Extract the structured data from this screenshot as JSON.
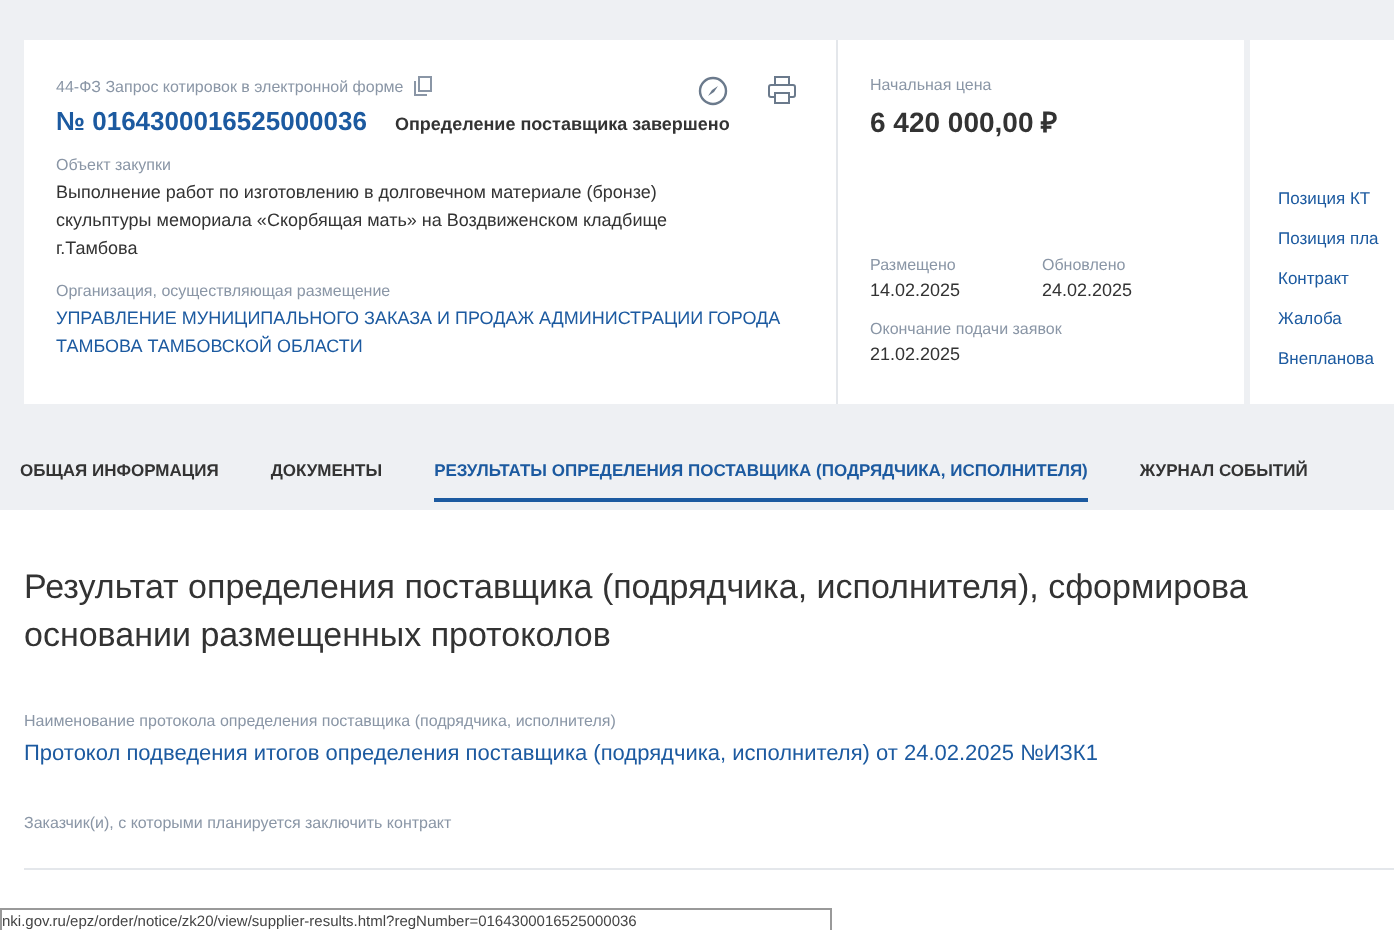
{
  "card": {
    "law_type": "44-ФЗ Запрос котировок в электронной форме",
    "number": "№ 0164300016525000036",
    "status": "Определение поставщика завершено",
    "object_label": "Объект закупки",
    "object_text": "Выполнение работ по изготовлению в долговечном материале (бронзе) скульптуры мемориала «Скорбящая мать» на Воздвиженском кладбище г.Тамбова",
    "org_label": "Организация, осуществляющая размещение",
    "org_name": "УПРАВЛЕНИЕ МУНИЦИПАЛЬНОГО ЗАКАЗА И ПРОДАЖ АДМИНИСТРАЦИИ ГОРОДА ТАМБОВА ТАМБОВСКОЙ ОБЛАСТИ"
  },
  "price": {
    "label": "Начальная цена",
    "value": "6 420 000,00 ₽"
  },
  "dates": [
    {
      "label": "Размещено",
      "value": "14.02.2025"
    },
    {
      "label": "Обновлено",
      "value": "24.02.2025"
    },
    {
      "label": "Окончание подачи заявок",
      "value": "21.02.2025"
    }
  ],
  "links": [
    "Позиция КТ",
    "Позиция пла",
    "Контракт",
    "Жалоба",
    "Внепланова"
  ],
  "tabs": [
    {
      "label": "ОБЩАЯ ИНФОРМАЦИЯ",
      "selected": false
    },
    {
      "label": "ДОКУМЕНТЫ",
      "selected": false
    },
    {
      "label": "РЕЗУЛЬТАТЫ ОПРЕДЕЛЕНИЯ ПОСТАВЩИКА (ПОДРЯДЧИКА, ИСПОЛНИТЕЛЯ)",
      "selected": true
    },
    {
      "label": "ЖУРНАЛ СОБЫТИЙ",
      "selected": false
    }
  ],
  "heading_lines": [
    "Результат определения поставщика (подрядчика, исполнителя), сформирова",
    "основании размещенных протоколов"
  ],
  "protocol": {
    "label": "Наименование протокола определения поставщика (подрядчика, исполнителя)",
    "title": "Протокол подведения итогов определения поставщика (подрядчика, исполнителя) от 24.02.2025 №ИЗК1"
  },
  "customers_label": "Заказчик(и), с которыми планируется заключить контракт",
  "status_url": "nki.gov.ru/epz/order/notice/zk20/view/supplier-results.html?regNumber=0164300016525000036"
}
